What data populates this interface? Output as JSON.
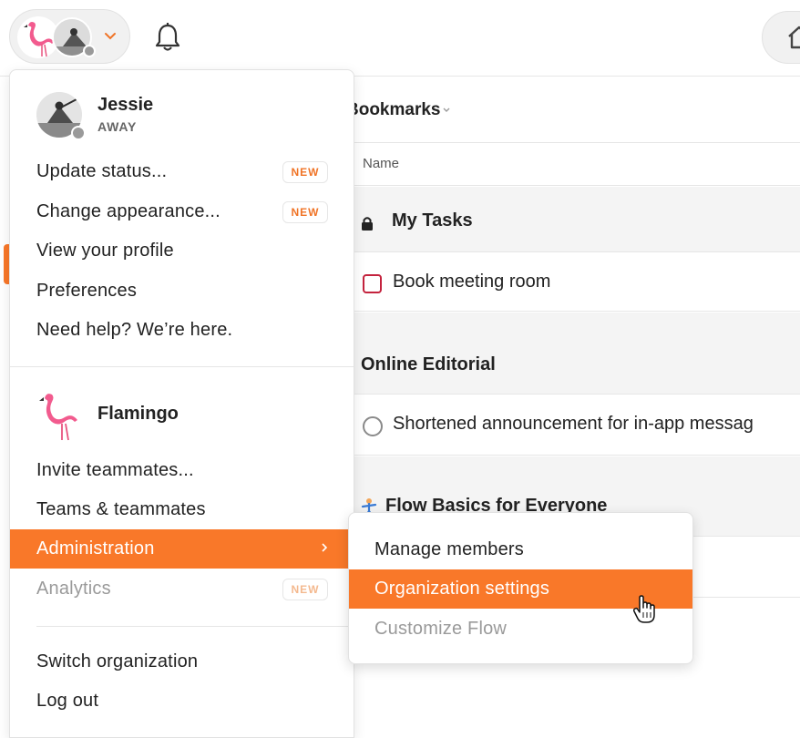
{
  "topbar": {
    "switcher_chevron_icon": "chevron-down-icon",
    "bell_icon": "bell-icon",
    "home_icon": "home-icon"
  },
  "content": {
    "bookmarks_title": "Bookmarks",
    "column_name": "Name",
    "rows": [
      {
        "type": "section",
        "label": "My Tasks",
        "icon": "lock-icon"
      },
      {
        "type": "task",
        "label": "Book meeting room",
        "checkbox": "square"
      },
      {
        "type": "section",
        "label": "Online Editorial"
      },
      {
        "type": "task",
        "label": "Shortened announcement for in-app messag",
        "checkbox": "circle"
      },
      {
        "type": "section",
        "label": "Flow Basics for Everyone",
        "icon": "flow-icon"
      }
    ]
  },
  "menu": {
    "user": {
      "name": "Jessie",
      "status": "AWAY"
    },
    "user_items": [
      {
        "label": "Update status...",
        "badge": "NEW"
      },
      {
        "label": "Change appearance...",
        "badge": "NEW"
      },
      {
        "label": "View your profile"
      },
      {
        "label": "Preferences"
      },
      {
        "label": "Need help? We’re here."
      }
    ],
    "org": {
      "name": "Flamingo"
    },
    "org_items": [
      {
        "label": "Invite teammates..."
      },
      {
        "label": "Teams & teammates"
      },
      {
        "label": "Administration",
        "active": true
      },
      {
        "label": "Analytics",
        "badge": "NEW",
        "disabled": true
      }
    ],
    "footer_items": [
      {
        "label": "Switch organization"
      },
      {
        "label": "Log out"
      }
    ]
  },
  "submenu": {
    "items": [
      {
        "label": "Manage members"
      },
      {
        "label": "Organization settings",
        "active": true
      },
      {
        "label": "Customize Flow",
        "disabled": true
      }
    ]
  },
  "colors": {
    "accent": "#f97829",
    "badge_text": "#f07427",
    "checkbox_red": "#c4233e"
  }
}
